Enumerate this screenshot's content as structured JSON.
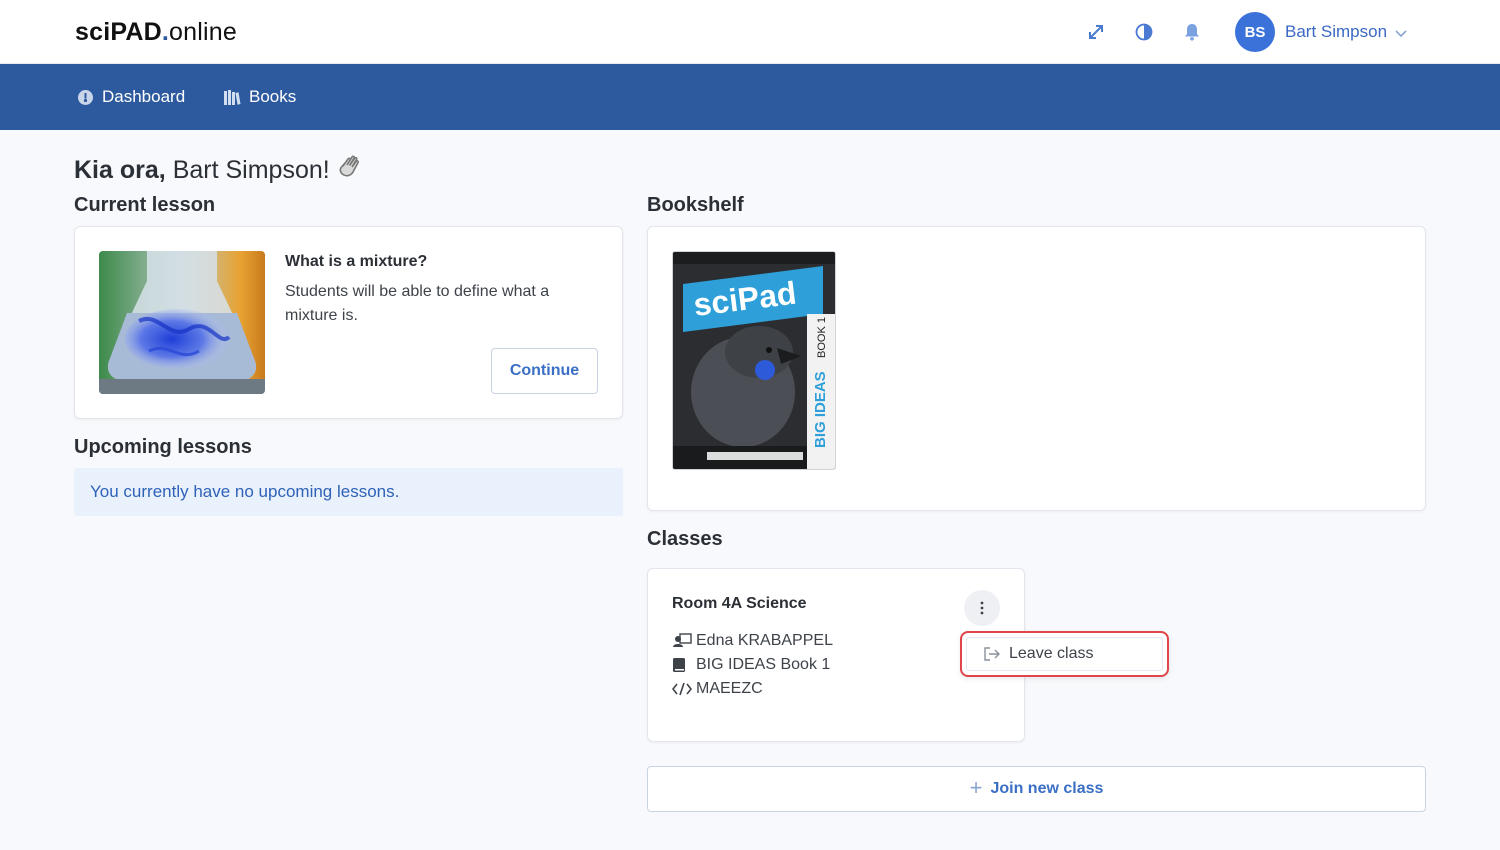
{
  "header": {
    "logo_bold": "sciPAD",
    "logo_dot": ".",
    "logo_rest": "online",
    "user": {
      "initials": "BS",
      "name": "Bart Simpson"
    },
    "icons": [
      "expand-icon",
      "contrast-icon",
      "bell-icon",
      "chevron-down-icon"
    ]
  },
  "nav": {
    "items": [
      {
        "label": "Dashboard",
        "icon": "dashboard-icon"
      },
      {
        "label": "Books",
        "icon": "books-icon"
      }
    ]
  },
  "greeting": {
    "prefix": "Kia ora,",
    "name": "Bart Simpson!",
    "emoji": "wave-icon"
  },
  "current_lesson": {
    "heading": "Current lesson",
    "title": "What is a mixture?",
    "description": "Students will be able to define what a mixture is.",
    "button": "Continue"
  },
  "upcoming": {
    "heading": "Upcoming lessons",
    "message": "You currently have no upcoming lessons."
  },
  "bookshelf": {
    "heading": "Bookshelf",
    "books": [
      {
        "brand": "sciPad",
        "subtitle": "BIG IDEAS",
        "book_no": "BOOK 1"
      }
    ]
  },
  "classes": {
    "heading": "Classes",
    "items": [
      {
        "name": "Room 4A Science",
        "teacher": "Edna KRABAPPEL",
        "book": "BIG IDEAS Book 1",
        "code": "MAEEZC"
      }
    ],
    "menu": {
      "leave_label": "Leave class"
    },
    "join_label": "Join new class"
  },
  "colors": {
    "nav_bg": "#2d5a9e",
    "accent": "#3a6fc6",
    "avatar": "#3b72d9",
    "highlight_border": "#e0454a"
  }
}
